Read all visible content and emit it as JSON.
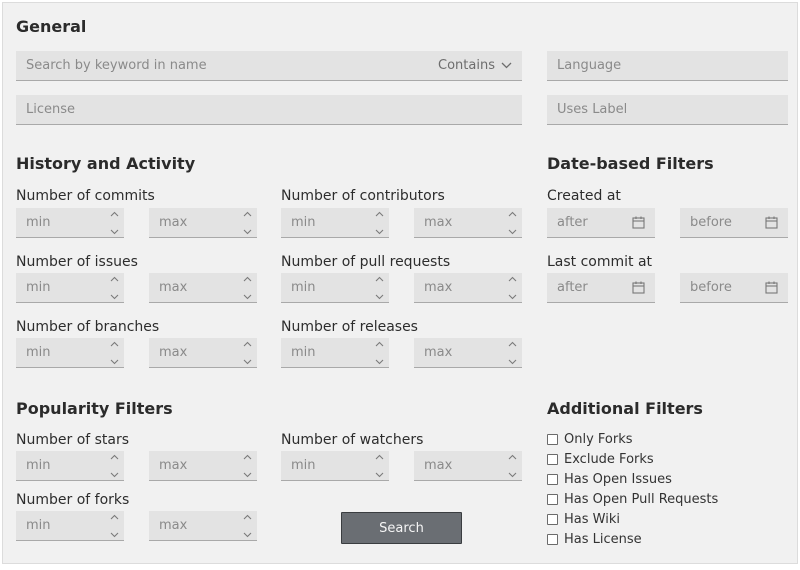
{
  "general": {
    "title": "General",
    "search_placeholder": "Search by keyword in name",
    "match_mode": "Contains",
    "language_placeholder": "Language",
    "license_placeholder": "License",
    "uses_label_placeholder": "Uses Label"
  },
  "history": {
    "title": "History and Activity",
    "commits_label": "Number of commits",
    "contributors_label": "Number of contributors",
    "issues_label": "Number of issues",
    "pull_requests_label": "Number of pull requests",
    "branches_label": "Number of branches",
    "releases_label": "Number of releases"
  },
  "dates": {
    "title": "Date-based Filters",
    "created_label": "Created at",
    "last_commit_label": "Last commit at",
    "after_placeholder": "after",
    "before_placeholder": "before"
  },
  "popularity": {
    "title": "Popularity Filters",
    "stars_label": "Number of stars",
    "watchers_label": "Number of watchers",
    "forks_label": "Number of forks"
  },
  "additional": {
    "title": "Additional Filters",
    "options": [
      "Only Forks",
      "Exclude Forks",
      "Has Open Issues",
      "Has Open Pull Requests",
      "Has Wiki",
      "Has License"
    ]
  },
  "range": {
    "min_placeholder": "min",
    "max_placeholder": "max"
  },
  "search_button": "Search",
  "colors": {
    "panel_bg": "#f1f1f1",
    "field_bg": "#e3e3e3",
    "button_bg": "#6a6e73"
  }
}
